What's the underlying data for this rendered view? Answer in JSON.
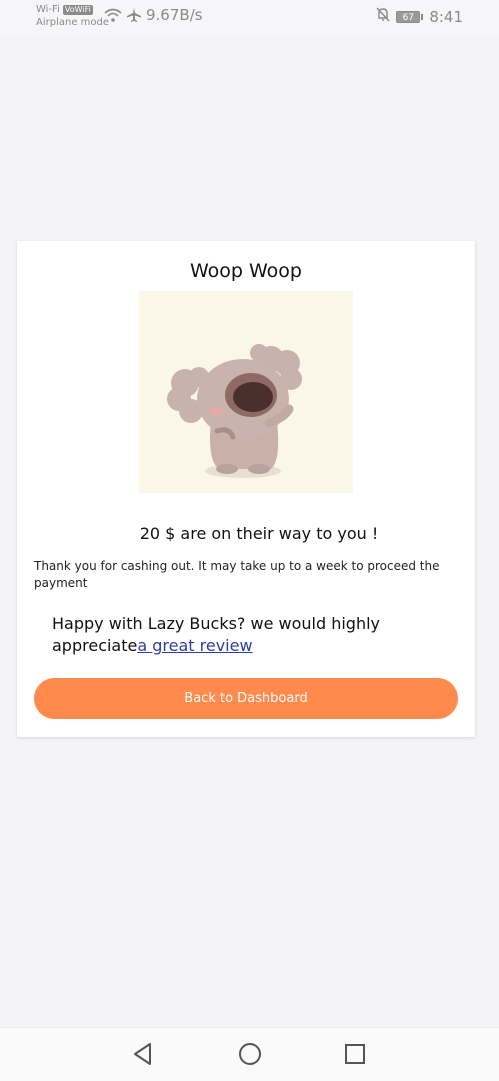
{
  "status_bar": {
    "wifi_label": "Wi-Fi",
    "vowifi_badge": "VoWiFi",
    "airplane_label": "Airplane mode",
    "net_speed": "9.67B/s",
    "battery": "67",
    "time": "8:41",
    "icons": [
      "wifi-icon",
      "airplane-icon",
      "bell-muted-icon",
      "battery-icon"
    ]
  },
  "card": {
    "title": "Woop Woop",
    "image_name": "koala-illustration",
    "amount_text": "20 $ are on their way to you !",
    "thanks_text": "Thank you for cashing out. It may take up to a week to proceed the payment",
    "review_prefix": "Happy with Lazy Bucks? we would highly appreciate",
    "review_link": "a great review",
    "button_label": "Back to Dashboard",
    "button_color": "#ff8a4c"
  },
  "nav_bar": {
    "icons": [
      "back-triangle-icon",
      "home-circle-icon",
      "recents-square-icon"
    ]
  }
}
